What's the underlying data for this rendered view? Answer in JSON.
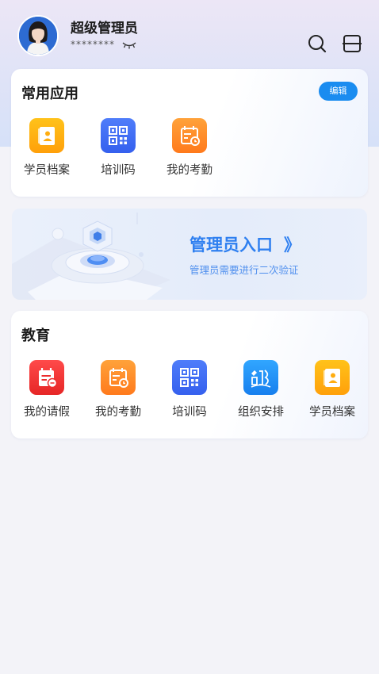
{
  "user": {
    "name": "超级管理员",
    "password_mask": "********"
  },
  "common_apps": {
    "title": "常用应用",
    "edit_label": "编辑",
    "items": [
      {
        "label": "学员档案",
        "icon": "student-file-icon",
        "color": "#ffb012"
      },
      {
        "label": "培训码",
        "icon": "qr-code-icon",
        "color": "#3f6ef4"
      },
      {
        "label": "我的考勤",
        "icon": "attendance-icon",
        "color": "#ff8e28"
      }
    ]
  },
  "banner": {
    "title": "管理员入口",
    "arrow": "》",
    "subtitle": "管理员需要进行二次验证"
  },
  "education": {
    "title": "教育",
    "items": [
      {
        "label": "我的请假",
        "icon": "leave-request-icon",
        "color": "#f03434"
      },
      {
        "label": "我的考勤",
        "icon": "attendance-icon",
        "color": "#ff8e28"
      },
      {
        "label": "培训码",
        "icon": "qr-code-icon",
        "color": "#3f6ef4"
      },
      {
        "label": "组织安排",
        "icon": "organization-icon",
        "color": "#2596f7"
      },
      {
        "label": "学员档案",
        "icon": "student-file-icon",
        "color": "#ffb012"
      }
    ]
  }
}
